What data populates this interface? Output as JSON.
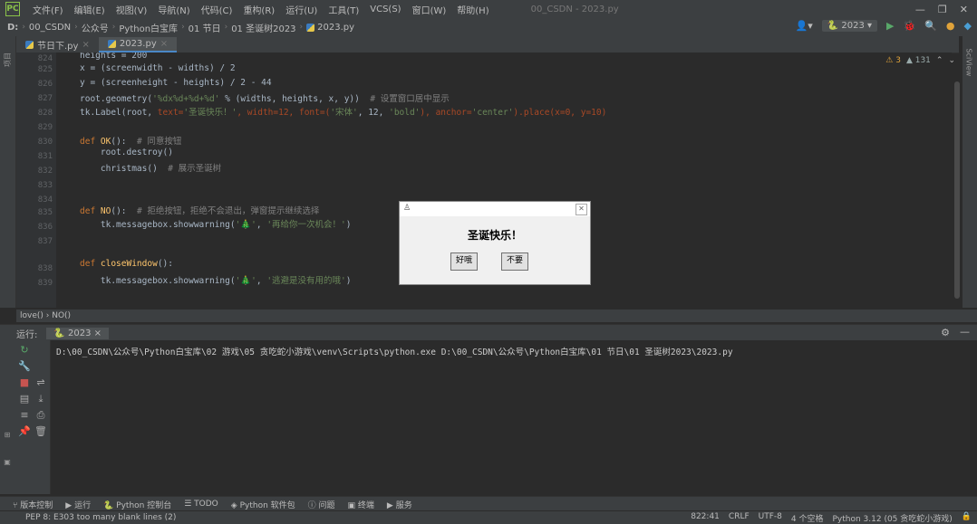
{
  "menubar": {
    "app_icon": "PC",
    "items": [
      "文件(F)",
      "编辑(E)",
      "视图(V)",
      "导航(N)",
      "代码(C)",
      "重构(R)",
      "运行(U)",
      "工具(T)",
      "VCS(S)",
      "窗口(W)",
      "帮助(H)"
    ],
    "window_title": "00_CSDN - 2023.py",
    "controls": [
      "—",
      "❐",
      "✕"
    ]
  },
  "navbar": {
    "crumbs": [
      "D:",
      "00_CSDN",
      "公众号",
      "Python白宝库",
      "01 节日",
      "01 圣诞树2023",
      "2023.py"
    ],
    "run_config": "2023",
    "icons": [
      "user-icon",
      "run-config",
      "play-icon",
      "debug-icon",
      "search-icon",
      "update-icon",
      "plugin-icon"
    ]
  },
  "tabs": [
    {
      "label": "节日下.py",
      "active": false
    },
    {
      "label": "2023.py",
      "active": true
    }
  ],
  "gutter": {
    "line_numbers": [
      "824",
      "825",
      "826",
      "827",
      "828",
      "829",
      "830",
      "831",
      "832",
      "833",
      "834",
      "835",
      "836",
      "837",
      "838",
      "839"
    ]
  },
  "inspection": {
    "warnings": "⚠ 3",
    "weak": "▲ 131",
    "up": "⌃",
    "down": "⌄"
  },
  "code": {
    "l0": "heights = 200",
    "l1": "x = (screenwidth - widths) / 2",
    "l2": "y = (screenheight - heights) / 2 - 44",
    "l3a": "root.geometry(",
    "l3b": "'%dx%d+%d+%d'",
    "l3c": " % (widths, heights, x, y))  ",
    "l3d": "# 设置窗口居中显示",
    "l4a": "tk.Label(root, ",
    "l4b": "text=",
    "l4c": "'圣诞快乐！'",
    "l4d": ", width=12, font=(",
    "l4e": "'宋体'",
    "l4f": ", 12, ",
    "l4g": "'bold'",
    "l4h": "), anchor=",
    "l4i": "'center'",
    "l4j": ").place(x=0, y=10)",
    "l5a": "def ",
    "l5b": "OK",
    "l5c": "():  ",
    "l5d": "# 同意按钮",
    "l6": "    root.destroy()",
    "l7a": "    christmas()  ",
    "l7b": "# 展示圣诞树",
    "l8a": "def ",
    "l8b": "NO",
    "l8c": "():  ",
    "l8d": "# 拒绝按钮，拒绝不会退出，弹窗提示继续选择",
    "l9a": "    tk.messagebox.showwarning(",
    "l9b": "'🎄'",
    "l9c": ", ",
    "l9d": "'再给你一次机会！'",
    "l9e": ")",
    "l10a": "def ",
    "l10b": "closeWindow",
    "l10c": "():",
    "l11a": "    tk.messagebox.showwarning(",
    "l11b": "'🎄'",
    "l11c": ", ",
    "l11d": "'逃避是没有用的哦'",
    "l11e": ")"
  },
  "editor_breadcrumb": "love() › NO()",
  "run_panel": {
    "label": "运行:",
    "tab": "2023",
    "command": "D:\\00_CSDN\\公众号\\Python白宝库\\02 游戏\\05 贪吃蛇小游戏\\venv\\Scripts\\python.exe D:\\00_CSDN\\公众号\\Python白宝库\\01 节日\\01 圣诞树2023\\2023.py"
  },
  "bottom_tabs": [
    "版本控制",
    "运行",
    "Python 控制台",
    "TODO",
    "Python 软件包",
    "问题",
    "终端",
    "服务"
  ],
  "status": {
    "message": "PEP 8: E303 too many blank lines (2)",
    "position": "822:41",
    "line_sep": "CRLF",
    "encoding": "UTF-8",
    "indent": "4 个空格",
    "interpreter": "Python 3.12 (05 贪吃蛇小游戏)"
  },
  "dialog": {
    "text": "圣诞快乐！",
    "ok_label": "好哦",
    "no_label": "不要",
    "close": "✕",
    "feather": "♙"
  },
  "sidebar_labels": {
    "right": "SciView",
    "left": "项目"
  }
}
